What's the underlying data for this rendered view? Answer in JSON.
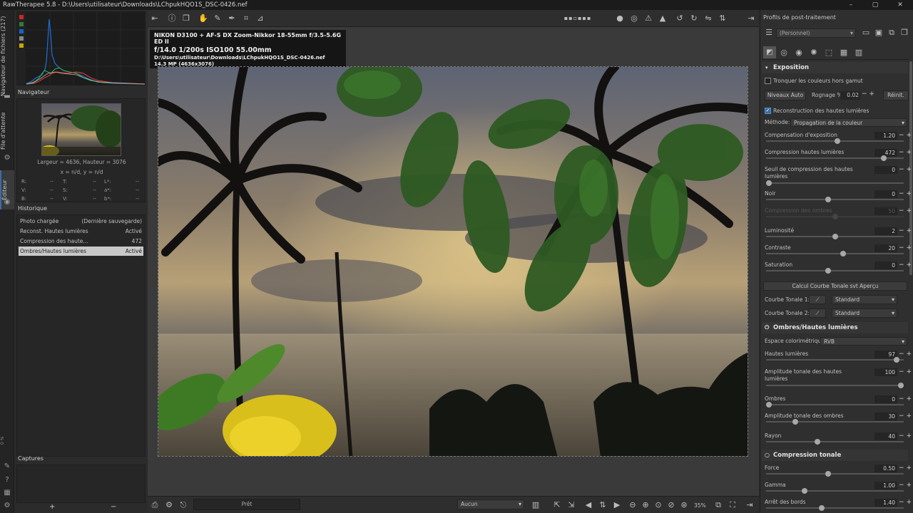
{
  "window": {
    "title": "RawTherapee 5.8 - D:\\Users\\utilisateur\\Downloads\\LChpukHQO1S_DSC-0426.nef",
    "minimize": "–",
    "maximize": "▢",
    "close": "✕"
  },
  "vertical_tabs": {
    "file_browser": "Navigateur de fichiers (217)",
    "queue": "File d'attente",
    "editor": "Éditeur",
    "zoom_pct": "0 %"
  },
  "navigator": {
    "title": "Navigateur",
    "dimensions": "Largeur = 4636, Hauteur = 3076",
    "coords": "x = n/d, y = n/d",
    "readouts": [
      {
        "l": "R:",
        "v": "--"
      },
      {
        "l": "T:",
        "v": "--"
      },
      {
        "l": "L*:",
        "v": "--"
      },
      {
        "l": "V:",
        "v": "--"
      },
      {
        "l": "S:",
        "v": "--"
      },
      {
        "l": "a*:",
        "v": "--"
      },
      {
        "l": "B:",
        "v": "--"
      },
      {
        "l": "V:",
        "v": "--"
      },
      {
        "l": "b*:",
        "v": "--"
      }
    ]
  },
  "history": {
    "title": "Historique",
    "rows": [
      {
        "name": "Photo chargée",
        "value": "(Dernière sauvegarde)"
      },
      {
        "name": "Reconst. Hautes lumières",
        "value": "Activé"
      },
      {
        "name": "Compression des haute...",
        "value": "472"
      },
      {
        "name": "Ombres/Hautes lumières",
        "value": "Activé"
      }
    ]
  },
  "captures": {
    "title": "Captures",
    "add": "+",
    "remove": "−"
  },
  "image_info": {
    "line1": "NIKON D3100 + AF-S DX Zoom-Nikkor 18-55mm f/3.5-5.6G ED II",
    "line2": "f/14.0  1/200s  ISO100  55.00mm",
    "line3": "D:\\Users\\utilisateur\\Downloads\\LChpukHQO1S_DSC-0426.nef",
    "line4": "14.3 MP (4636x3076)"
  },
  "bottom": {
    "status": "Prêt",
    "output_combo": "Aucun",
    "zoom": "35%"
  },
  "profile": {
    "title": "Profils de post-traitement",
    "selected": "(Personnel)"
  },
  "exposure": {
    "title": "Exposition",
    "clip_label": "Tronquer les couleurs hors gamut",
    "auto_levels": "Niveaux Auto",
    "clip_pct_label": "Rognage %",
    "clip_pct": "0.02",
    "reset": "Réinit.",
    "hl_recon_label": "Reconstruction des hautes lumières",
    "method_label": "Méthode:",
    "method_value": "Propagation de la couleur",
    "sliders": [
      {
        "label": "Compensation d'exposition",
        "value": "1.20",
        "pos": 0.52
      },
      {
        "label": "Compression hautes lumières",
        "value": "472",
        "pos": 0.87
      },
      {
        "label": "Seuil de compression des hautes lumières",
        "value": "0",
        "pos": 0.0
      },
      {
        "label": "Noir",
        "value": "0",
        "pos": 0.45
      },
      {
        "label": "Compression des ombres",
        "value": "50",
        "pos": 0.5
      },
      {
        "label": "Luminosité",
        "value": "2",
        "pos": 0.5
      },
      {
        "label": "Contraste",
        "value": "20",
        "pos": 0.56
      },
      {
        "label": "Saturation",
        "value": "0",
        "pos": 0.45
      }
    ],
    "calc_curve": "Calcul Courbe Tonale svt Aperçu",
    "curve1_label": "Courbe Tonale 1:",
    "curve1_value": "Standard",
    "curve2_label": "Courbe Tonale 2:",
    "curve2_value": "Standard"
  },
  "shadows_highlights": {
    "title": "Ombres/Hautes lumières",
    "colorspace_label": "Espace colorimétrique:",
    "colorspace_value": "RVB",
    "sliders": [
      {
        "label": "Hautes lumières",
        "value": "97",
        "pos": 0.97
      },
      {
        "label": "Amplitude tonale des hautes lumières",
        "value": "100",
        "pos": 1.0
      },
      {
        "label": "Ombres",
        "value": "0",
        "pos": 0.0
      },
      {
        "label": "Amplitude tonale des ombres",
        "value": "30",
        "pos": 0.2
      },
      {
        "label": "Rayon",
        "value": "40",
        "pos": 0.37
      }
    ]
  },
  "tone_compression": {
    "title": "Compression tonale",
    "sliders": [
      {
        "label": "Force",
        "value": "0.50",
        "pos": 0.45
      },
      {
        "label": "Gamma",
        "value": "1.00",
        "pos": 0.27
      },
      {
        "label": "Arrêt des bords",
        "value": "1.40",
        "pos": 0.4
      }
    ]
  },
  "colors": {
    "accent": "#3a6ea5",
    "panel_bg": "#2f2f2f",
    "section_header": "#353535"
  }
}
